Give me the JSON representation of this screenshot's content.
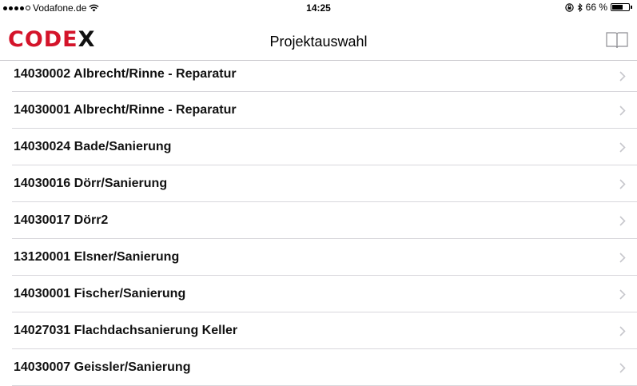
{
  "status": {
    "carrier": "Vodafone.de",
    "time": "14:25",
    "battery": "66 %",
    "battery_level": 0.66,
    "signal_dots_filled": 4,
    "icons": [
      "wifi-icon",
      "lock-rotation-icon",
      "bluetooth-icon",
      "battery-icon"
    ]
  },
  "header": {
    "logo_text": "CODE",
    "logo_x": "X",
    "title": "Projektauswahl",
    "book_icon": "book-icon"
  },
  "colors": {
    "brand": "#d4142a",
    "separator": "#d8d7dc",
    "chevron": "#c7c7cc"
  },
  "projects": [
    "14030002 Albrecht/Rinne  - Reparatur",
    "14030001 Albrecht/Rinne  - Reparatur",
    "14030024 Bade/Sanierung",
    "14030016 Dörr/Sanierung",
    "14030017 Dörr2",
    "13120001 Elsner/Sanierung",
    "14030001 Fischer/Sanierung",
    "14027031 Flachdachsanierung Keller",
    "14030007 Geissler/Sanierung"
  ]
}
